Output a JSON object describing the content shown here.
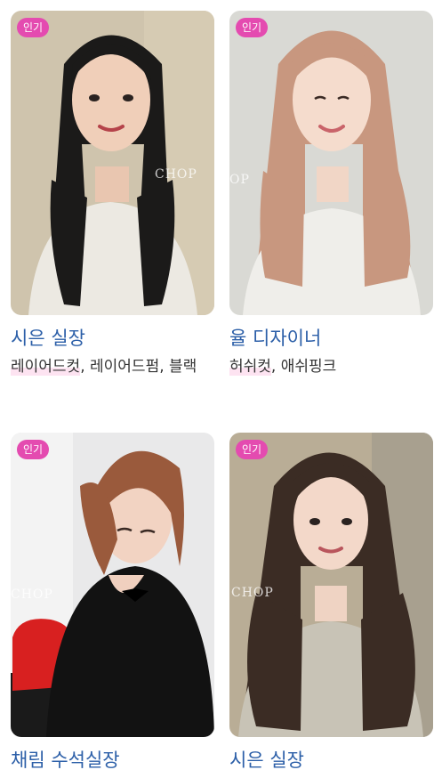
{
  "cards": [
    {
      "badge": "인기",
      "name": "시은 실장",
      "tags_highlight": "레이어드컷",
      "tags_rest": ", 레이어드펌, 블랙",
      "watermark": "CHOP",
      "hair_color": "#1b1a19",
      "bg_color": "#cfc4ad",
      "top_color": "#ece9e2"
    },
    {
      "badge": "인기",
      "name": "율 디자이너",
      "tags_highlight": "허쉬컷",
      "tags_rest": ", 애쉬핑크",
      "watermark": "OP",
      "hair_color": "#c8977f",
      "bg_color": "#d9d9d4",
      "top_color": "#efeeea"
    },
    {
      "badge": "인기",
      "name": "채림 수석실장",
      "tags_highlight": "",
      "tags_rest": "",
      "watermark": "CHOP",
      "hair_color": "#9a5a3c",
      "bg_color": "#e9e9ea",
      "top_color": "#121212"
    },
    {
      "badge": "인기",
      "name": "시은 실장",
      "tags_highlight": "",
      "tags_rest": "",
      "watermark": "CHOP",
      "hair_color": "#3b2c24",
      "bg_color": "#b9ad96",
      "top_color": "#c8c3b6"
    }
  ]
}
